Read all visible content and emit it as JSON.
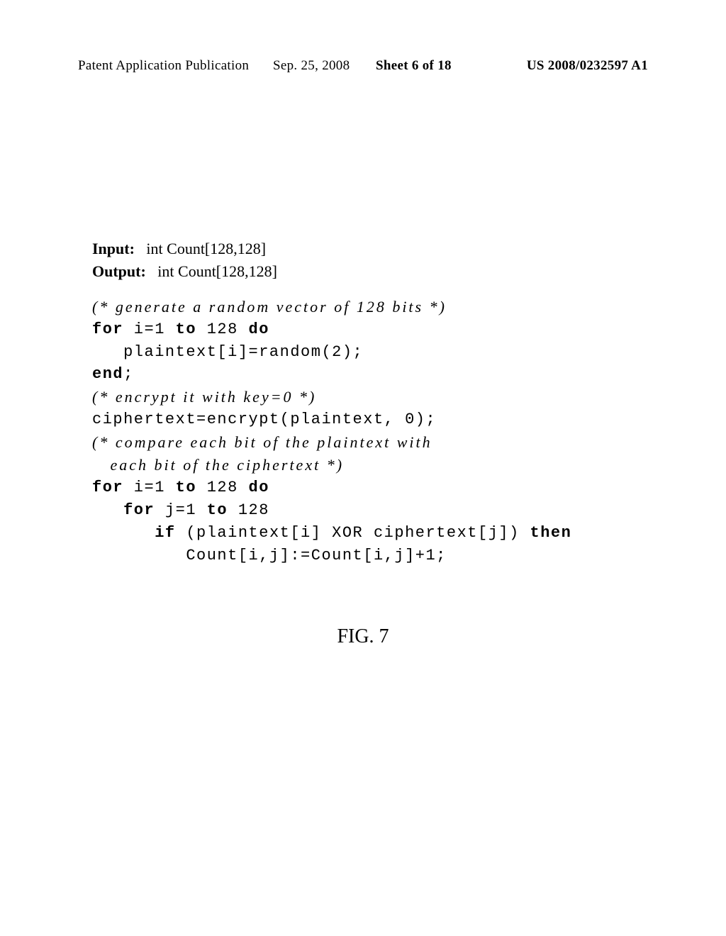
{
  "header": {
    "publication_text": "Patent Application Publication",
    "date": "Sep. 25, 2008",
    "sheet": "Sheet 6 of 18",
    "patent_number": "US 2008/0232597 A1"
  },
  "code": {
    "input_label": "Input:",
    "input_value": "int Count[128,128]",
    "output_label": "Output:",
    "output_value": "int Count[128,128]",
    "comment1": "(* generate a random vector of 128 bits *)",
    "line1a": "for",
    "line1b": " i=1 ",
    "line1c": "to",
    "line1d": " 128 ",
    "line1e": "do",
    "line2": "   plaintext[i]=random(2);",
    "line3a": "end",
    "line3b": ";",
    "comment2": "(* encrypt it with key=0 *)",
    "line4": "ciphertext=encrypt(plaintext, 0);",
    "comment3a": "(* compare each bit of the plaintext with",
    "comment3b": "   each bit of the ciphertext *)",
    "line5a": "for",
    "line5b": " i=1 ",
    "line5c": "to",
    "line5d": " 128 ",
    "line5e": "do",
    "line6a": "   for",
    "line6b": " j=1 ",
    "line6c": "to",
    "line6d": " 128",
    "line7a": "      if",
    "line7b": " (plaintext[i] XOR ciphertext[j]) ",
    "line7c": "then",
    "line8": "         Count[i,j]:=Count[i,j]+1;"
  },
  "figure": {
    "caption": "FIG. 7"
  }
}
